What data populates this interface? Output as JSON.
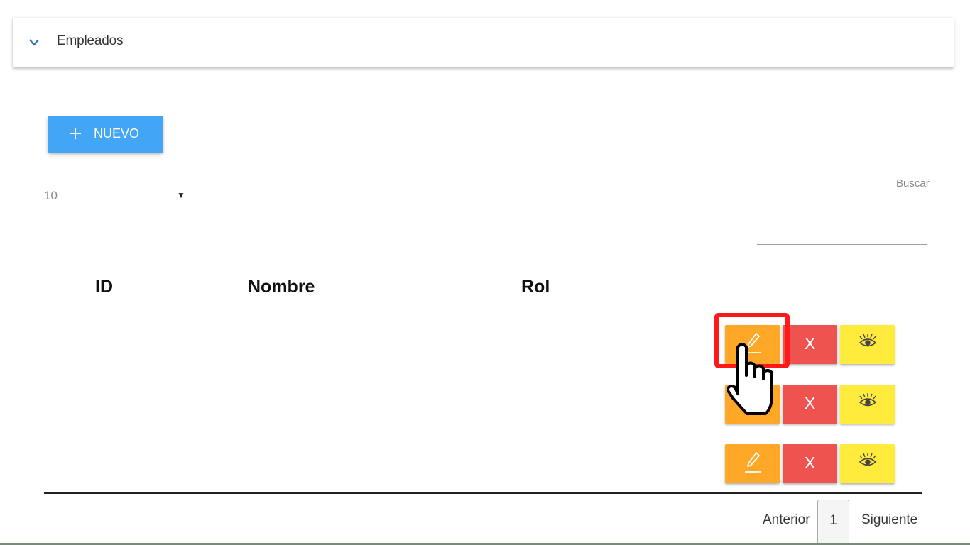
{
  "panel": {
    "title": "Empleados"
  },
  "toolbar": {
    "new_label": "NUEVO"
  },
  "page_size": {
    "value": "10"
  },
  "search": {
    "label": "Buscar",
    "value": ""
  },
  "table": {
    "columns": [
      "ID",
      "Nombre",
      "Rol"
    ],
    "rows": [
      {
        "actions": {
          "delete": "X"
        }
      },
      {
        "actions": {
          "delete": "X"
        }
      },
      {
        "actions": {
          "delete": "X"
        }
      }
    ]
  },
  "pagination": {
    "prev": "Anterior",
    "current": "1",
    "next": "Siguiente"
  },
  "colors": {
    "primary": "#42a5f5",
    "edit": "#ffa726",
    "delete": "#ef5350",
    "view": "#ffeb3b",
    "highlight": "#ff1a1a"
  },
  "icons": {
    "expand": "chevron-down-icon",
    "new": "plus-icon",
    "edit": "pencil-icon",
    "view": "eye-icon",
    "cursor": "hand-pointer-icon"
  }
}
